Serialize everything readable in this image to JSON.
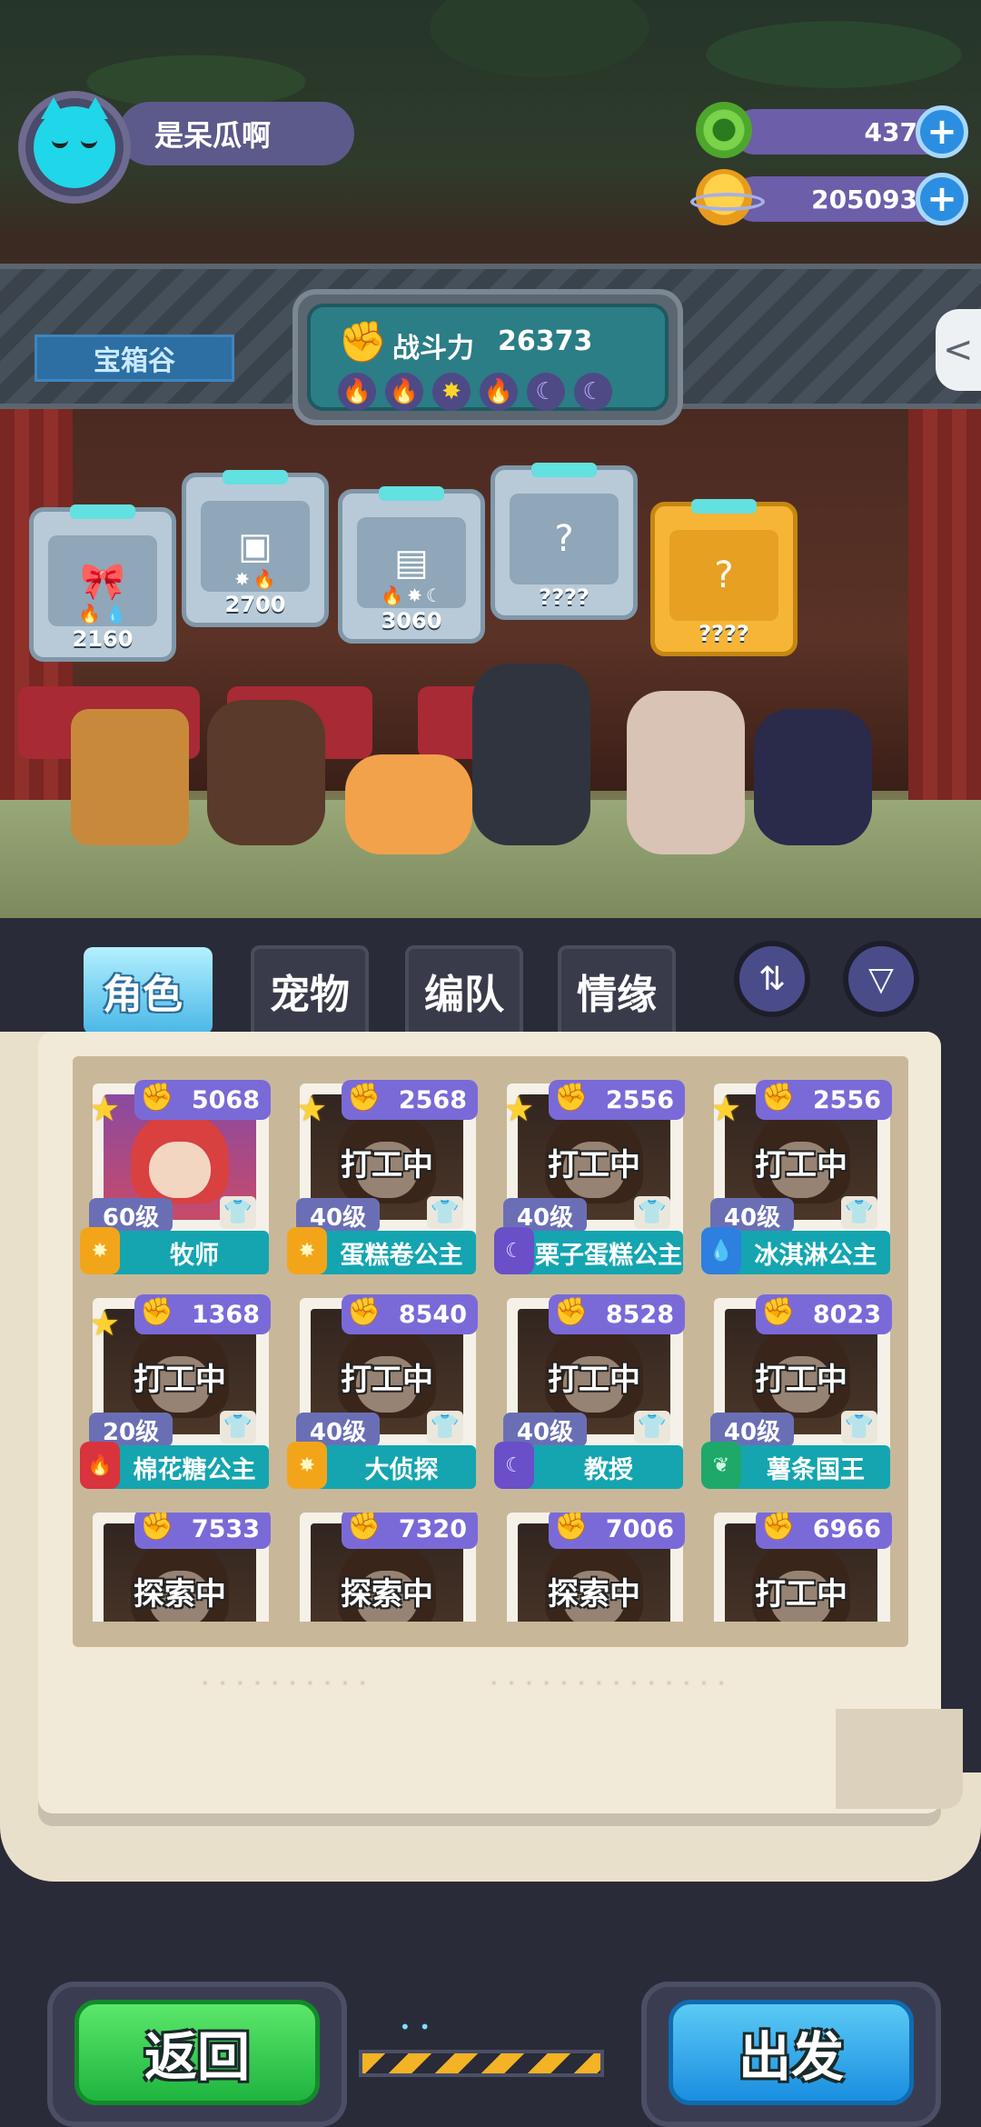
{
  "player": {
    "name": "是呆瓜啊",
    "avatar_icon": "cyan-cat-avatar-icon"
  },
  "currency": [
    {
      "icon": "green-coin-icon",
      "value": "437"
    },
    {
      "icon": "gold-planet-coin-icon",
      "value": "205093"
    }
  ],
  "location": "宝箱谷",
  "combat_power": {
    "label": "战斗力",
    "value": "26373",
    "elements": [
      "fire",
      "fire",
      "sun",
      "fire",
      "moon",
      "moon"
    ]
  },
  "chests": [
    {
      "cost": "2160",
      "reqs": [
        "fire",
        "water"
      ]
    },
    {
      "cost": "2700",
      "reqs": [
        "sun",
        "fire"
      ]
    },
    {
      "cost": "3060",
      "reqs": [
        "fire",
        "sun",
        "moon"
      ]
    },
    {
      "cost": "????",
      "reqs": []
    },
    {
      "cost": "????",
      "reqs": []
    }
  ],
  "tabs": [
    "角色",
    "宠物",
    "编队",
    "情缘"
  ],
  "active_tab": "角色",
  "cards": [
    {
      "power": "5068",
      "level": "60级",
      "name": "牧师",
      "status": "",
      "star": true,
      "badge": "sun"
    },
    {
      "power": "2568",
      "level": "40级",
      "name": "蛋糕卷公主",
      "status": "打工中",
      "star": true,
      "badge": "sun"
    },
    {
      "power": "2556",
      "level": "40级",
      "name": "栗子蛋糕公主",
      "status": "打工中",
      "star": true,
      "badge": "moon"
    },
    {
      "power": "2556",
      "level": "40级",
      "name": "冰淇淋公主",
      "status": "打工中",
      "star": true,
      "badge": "water"
    },
    {
      "power": "1368",
      "level": "20级",
      "name": "棉花糖公主",
      "status": "打工中",
      "star": true,
      "badge": "fire"
    },
    {
      "power": "8540",
      "level": "40级",
      "name": "大侦探",
      "status": "打工中",
      "star": false,
      "badge": "sun"
    },
    {
      "power": "8528",
      "level": "40级",
      "name": "教授",
      "status": "打工中",
      "star": false,
      "badge": "moon"
    },
    {
      "power": "8023",
      "level": "40级",
      "name": "薯条国王",
      "status": "打工中",
      "star": false,
      "badge": "leaf"
    },
    {
      "power": "7533",
      "level": "",
      "name": "",
      "status": "探索中",
      "star": false,
      "badge": ""
    },
    {
      "power": "7320",
      "level": "",
      "name": "",
      "status": "探索中",
      "star": false,
      "badge": ""
    },
    {
      "power": "7006",
      "level": "",
      "name": "",
      "status": "探索中",
      "star": false,
      "badge": ""
    },
    {
      "power": "6966",
      "level": "",
      "name": "",
      "status": "打工中",
      "star": false,
      "badge": ""
    }
  ],
  "buttons": {
    "back": "返回",
    "go": "出发"
  },
  "colors": {
    "accent_teal": "#14a5b0",
    "power_purple": "#7a6ad8",
    "back_green": "#1fb440",
    "go_blue": "#1a8ee0"
  }
}
